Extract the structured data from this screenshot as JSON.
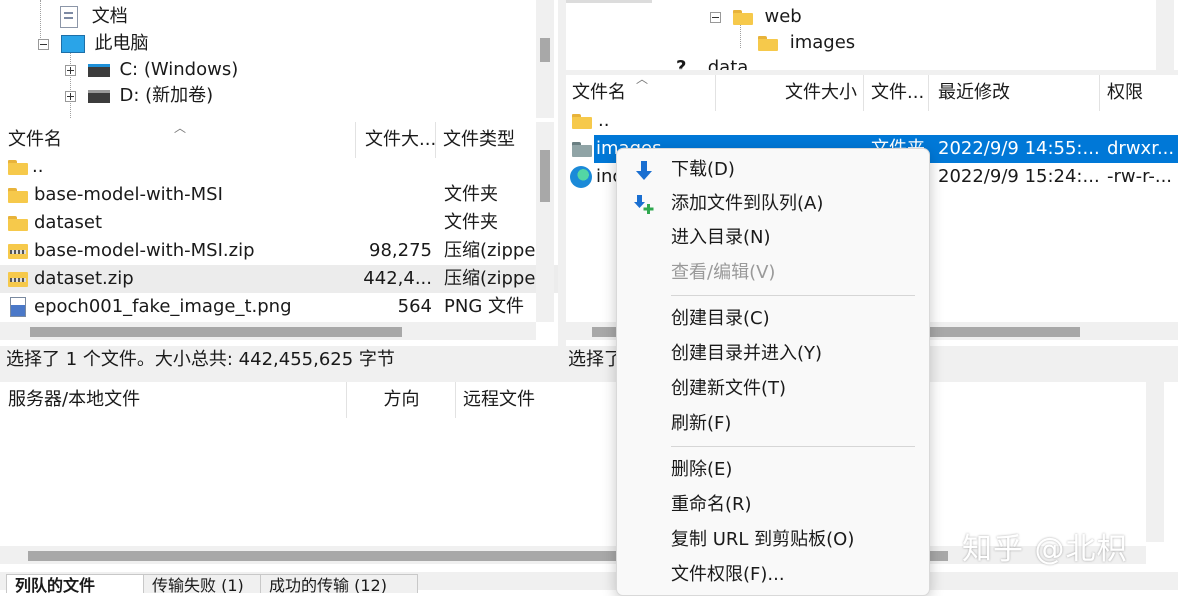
{
  "local_tree": {
    "items": [
      {
        "label": "文档",
        "icon": "document-icon"
      },
      {
        "label": "此电脑",
        "icon": "computer-icon"
      },
      {
        "label": "C: (Windows)",
        "icon": "drive-icon"
      },
      {
        "label": "D: (新加卷)",
        "icon": "drive-icon"
      }
    ]
  },
  "remote_tree": {
    "items": [
      {
        "label": "web",
        "icon": "folder-icon"
      },
      {
        "label": "images",
        "icon": "folder-icon"
      },
      {
        "label": "data",
        "icon": "unknown-folder-icon"
      }
    ]
  },
  "local_list": {
    "columns": [
      "文件名",
      "文件大...",
      "文件类型"
    ],
    "rows": [
      {
        "name": "..",
        "size": "",
        "type": "",
        "icon": "folder-icon"
      },
      {
        "name": "base-model-with-MSI",
        "size": "",
        "type": "文件夹",
        "icon": "folder-icon"
      },
      {
        "name": "dataset",
        "size": "",
        "type": "文件夹",
        "icon": "folder-icon"
      },
      {
        "name": "base-model-with-MSI.zip",
        "size": "98,275",
        "type": "压缩(zippe",
        "icon": "zip-icon"
      },
      {
        "name": "dataset.zip",
        "size": "442,4...",
        "type": "压缩(zippe",
        "icon": "zip-icon"
      },
      {
        "name": "epoch001_fake_image_t.png",
        "size": "564",
        "type": "PNG 文件",
        "icon": "png-icon"
      }
    ],
    "status": "选择了 1 个文件。大小总共: 442,455,625 字节"
  },
  "remote_list": {
    "columns": [
      "文件名",
      "文件大小",
      "文件...",
      "最近修改",
      "权限"
    ],
    "rows": [
      {
        "name": "..",
        "size": "",
        "type": "",
        "modified": "",
        "perms": "",
        "icon": "folder-icon"
      },
      {
        "name": "images",
        "size": "",
        "type": "文件夹",
        "modified": "2022/9/9 14:55:...",
        "perms": "drwxr...",
        "icon": "folder-icon"
      },
      {
        "name": "inc",
        "size": "",
        "type": "",
        "modified": "2022/9/9 15:24:...",
        "perms": "-rw-r-...",
        "icon": "edge-icon"
      }
    ],
    "status": "选择了"
  },
  "queue": {
    "columns": [
      "服务器/本地文件",
      "方向",
      "远程文件"
    ],
    "tabs": [
      "列队的文件",
      "传输失败 (1)",
      "成功的传输 (12)"
    ]
  },
  "context_menu": {
    "items": [
      {
        "label": "下载(D)",
        "icon": "download-arrow-icon",
        "disabled": false
      },
      {
        "label": "添加文件到队列(A)",
        "icon": "add-to-queue-icon",
        "disabled": false
      },
      {
        "label": "进入目录(N)",
        "icon": "",
        "disabled": false
      },
      {
        "label": "查看/编辑(V)",
        "icon": "",
        "disabled": true
      },
      {
        "label": "创建目录(C)",
        "icon": "",
        "disabled": false
      },
      {
        "label": "创建目录并进入(Y)",
        "icon": "",
        "disabled": false
      },
      {
        "label": "创建新文件(T)",
        "icon": "",
        "disabled": false
      },
      {
        "label": "刷新(F)",
        "icon": "",
        "disabled": false
      },
      {
        "label": "删除(E)",
        "icon": "",
        "disabled": false
      },
      {
        "label": "重命名(R)",
        "icon": "",
        "disabled": false
      },
      {
        "label": "复制 URL 到剪贴板(O)",
        "icon": "",
        "disabled": false
      },
      {
        "label": "文件权限(F)...",
        "icon": "",
        "disabled": false
      }
    ]
  },
  "watermark": "知乎 @北枳",
  "colors": {
    "selection": "#0078d7",
    "hover_row": "#e5f3ff",
    "menu_bg": "#f9f9f9",
    "download_arrow": "#1a6fd1",
    "add_queue_plus": "#2fa84f"
  }
}
